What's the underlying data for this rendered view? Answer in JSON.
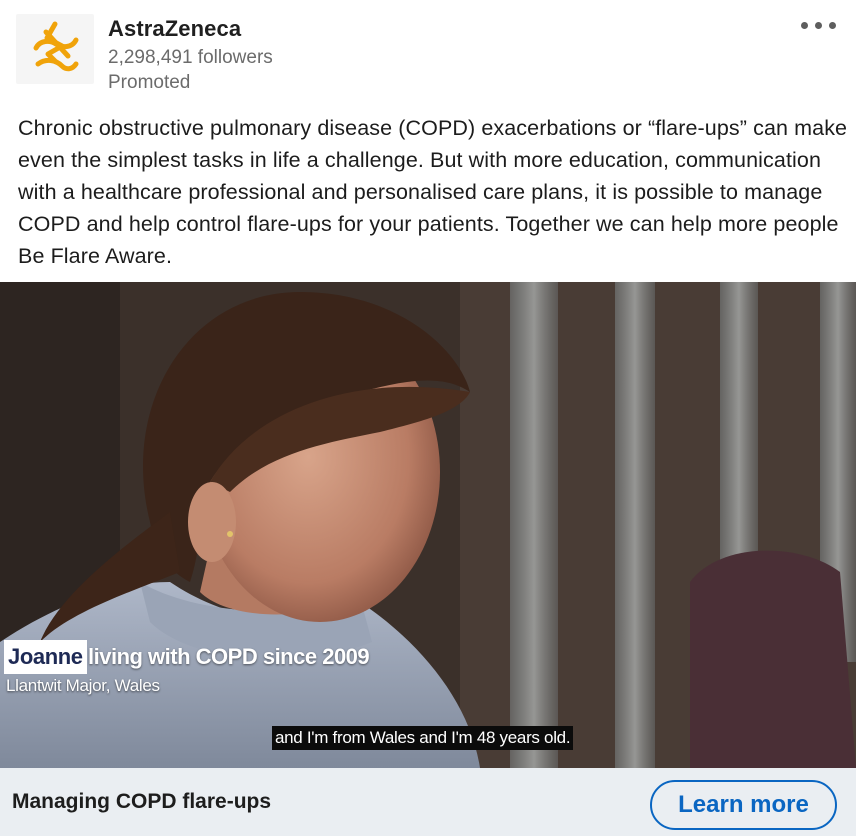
{
  "advertiser": {
    "name": "AstraZeneca",
    "followers": "2,298,491 followers",
    "label": "Promoted",
    "logo_icon": "astrazeneca-logo",
    "menu_icon": "more-horizontal-icon"
  },
  "post": {
    "text": "Chronic obstructive pulmonary disease (COPD) exacerbations or “flare-ups” can make even the simplest tasks in life a challenge. But with more education, communication with a healthcare professional and personalised care plans, it is possible to manage COPD and help control flare-ups for your patients. Together we can help more people Be Flare Aware."
  },
  "video": {
    "name_tag": "Joanne",
    "title_tag": "living with COPD since 2009",
    "location": "Llantwit Major, Wales",
    "caption": "and I'm from Wales and I'm 48 years old."
  },
  "cta": {
    "headline": "Managing COPD flare-ups",
    "button_label": "Learn more"
  },
  "colors": {
    "accent": "#0a66c2",
    "logo": "#f0a30a",
    "cta_background": "#eaeef2"
  }
}
